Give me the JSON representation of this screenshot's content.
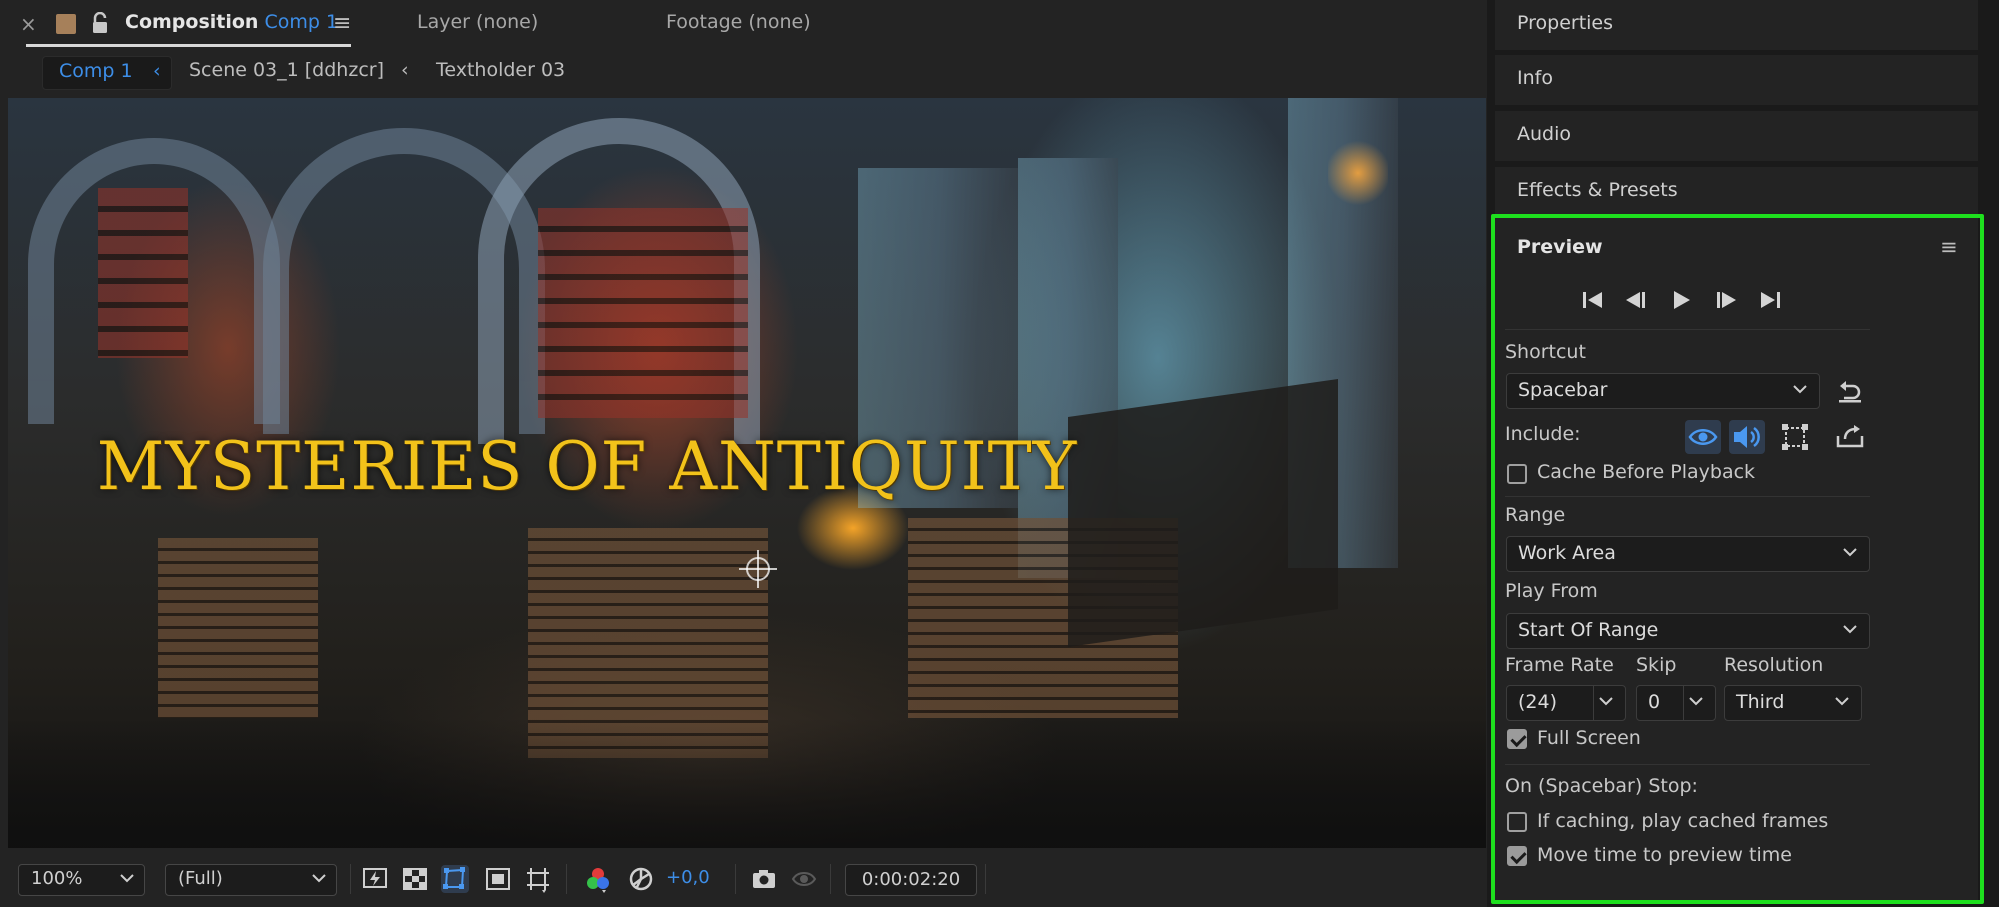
{
  "composition_panel": {
    "tab_close": "×",
    "tab_label": "Composition",
    "tab_comp": "Comp 1",
    "tab_menu": "≡",
    "layer_tab": "Layer (none)",
    "footage_tab": "Footage (none)",
    "breadcrumbs": [
      "Comp 1",
      "Scene 03_1 [ddhzcr]",
      "Textholder 03"
    ],
    "breadcrumb_separator": "‹",
    "viewer_text": "MYSTERIES OF ANTIQUITY",
    "toolbar": {
      "zoom": "100%",
      "resolution": "(Full)",
      "exposure": "+0,0",
      "timecode": "0:00:02:20"
    }
  },
  "right_panels": {
    "collapsed": [
      "Properties",
      "Info",
      "Audio",
      "Effects & Presets"
    ],
    "preview": {
      "title": "Preview",
      "menu": "≡",
      "shortcut_label": "Shortcut",
      "shortcut_value": "Spacebar",
      "include_label": "Include:",
      "cache_before_playback": {
        "label": "Cache Before Playback",
        "checked": false
      },
      "range_label": "Range",
      "range_value": "Work Area",
      "play_from_label": "Play From",
      "play_from_value": "Start Of Range",
      "frame_rate_label": "Frame Rate",
      "frame_rate_value": "(24)",
      "skip_label": "Skip",
      "skip_value": "0",
      "resolution_label": "Resolution",
      "resolution_value": "Third",
      "full_screen": {
        "label": "Full Screen",
        "checked": true
      },
      "on_stop_label": "On (Spacebar) Stop:",
      "if_caching": {
        "label": "If caching, play cached frames",
        "checked": false
      },
      "move_time": {
        "label": "Move time to preview time",
        "checked": true
      }
    }
  },
  "colors": {
    "accent_blue": "#3d8ee8",
    "highlight_green": "#1ee01e",
    "title_gold": "#f2c21a"
  }
}
